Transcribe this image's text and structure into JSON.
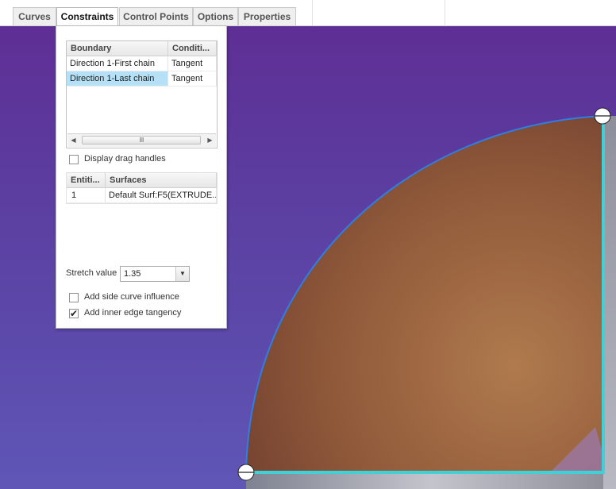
{
  "tabs": [
    {
      "label": "Curves",
      "active": false
    },
    {
      "label": "Constraints",
      "active": true
    },
    {
      "label": "Control Points",
      "active": false
    },
    {
      "label": "Options",
      "active": false
    },
    {
      "label": "Properties",
      "active": false
    }
  ],
  "boundary_table": {
    "headers": [
      "Boundary",
      "Conditi..."
    ],
    "rows": [
      {
        "boundary": "Direction 1-First chain",
        "condition": "Tangent",
        "selected": false
      },
      {
        "boundary": "Direction 1-Last chain",
        "condition": "Tangent",
        "selected": true
      }
    ],
    "scroll_thumb": "IIII"
  },
  "display_drag_handles": {
    "label": "Display drag handles",
    "checked": false
  },
  "surface_table": {
    "headers": [
      "Entiti...",
      "Surfaces"
    ],
    "rows": [
      {
        "entity": "1",
        "surface": "Default Surf:F5(EXTRUDE..."
      }
    ]
  },
  "stretch": {
    "label": "Stretch value",
    "value": "1.35"
  },
  "side_curve_influence": {
    "label": "Add side curve influence",
    "checked": false
  },
  "inner_edge_tangency": {
    "label": "Add inner edge tangency",
    "checked": true
  },
  "icons": {
    "check": "✔",
    "arrow_left": "◀",
    "arrow_right": "▶",
    "arrow_down": "▼"
  },
  "colors": {
    "viewport_top": "#5e2f95",
    "viewport_bottom": "#5f56b6",
    "surface": "#8f5535",
    "boundary_curve": "#3fd0d8",
    "edge_curve": "#2f7fe0",
    "selection": "#b6e0f5"
  }
}
